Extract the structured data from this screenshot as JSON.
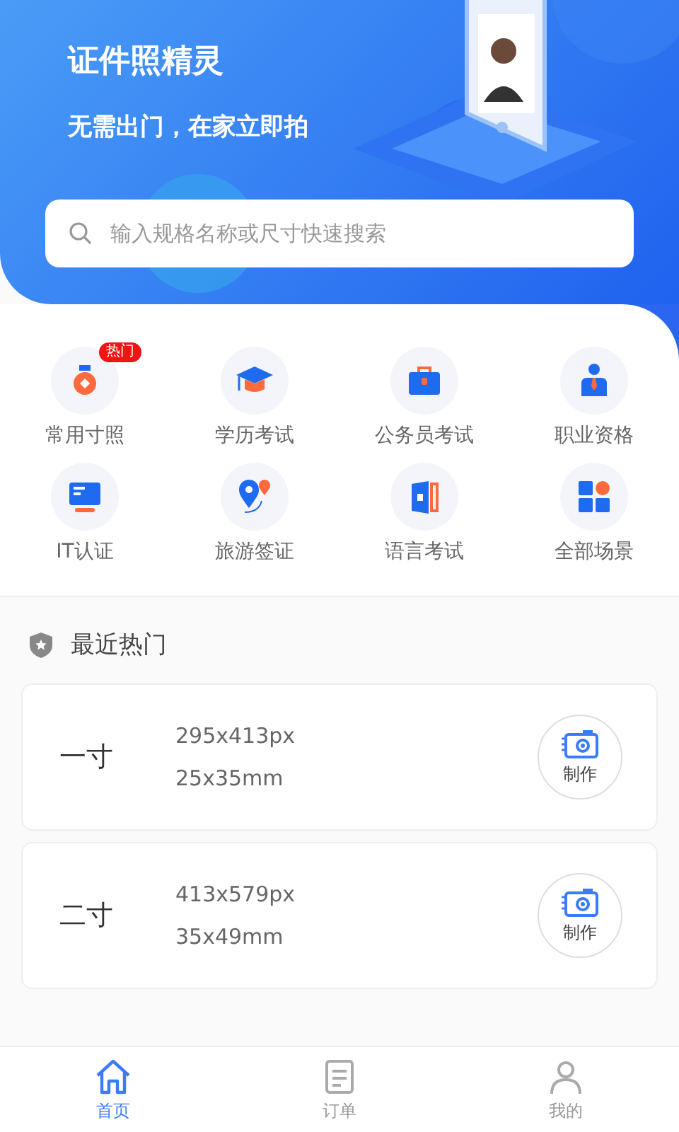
{
  "header": {
    "title": "证件照精灵",
    "subtitle": "无需出门，在家立即拍"
  },
  "search": {
    "placeholder": "输入规格名称或尺寸快速搜索"
  },
  "categories": [
    {
      "label": "常用寸照",
      "kind": "medal",
      "badge": "热门"
    },
    {
      "label": "学历考试",
      "kind": "cap"
    },
    {
      "label": "公务员考试",
      "kind": "briefcase"
    },
    {
      "label": "职业资格",
      "kind": "person"
    },
    {
      "label": "IT认证",
      "kind": "monitor"
    },
    {
      "label": "旅游签证",
      "kind": "pins"
    },
    {
      "label": "语言考试",
      "kind": "book"
    },
    {
      "label": "全部场景",
      "kind": "grid"
    }
  ],
  "recent": {
    "title": "最近热门",
    "items": [
      {
        "name": "一寸",
        "pixels": "295x413px",
        "size": "25x35mm",
        "action": "制作"
      },
      {
        "name": "二寸",
        "pixels": "413x579px",
        "size": "35x49mm",
        "action": "制作"
      }
    ]
  },
  "tabs": [
    {
      "label": "首页",
      "kind": "home",
      "selected": true
    },
    {
      "label": "订单",
      "kind": "orders",
      "selected": false
    },
    {
      "label": "我的",
      "kind": "profile",
      "selected": false
    }
  ]
}
